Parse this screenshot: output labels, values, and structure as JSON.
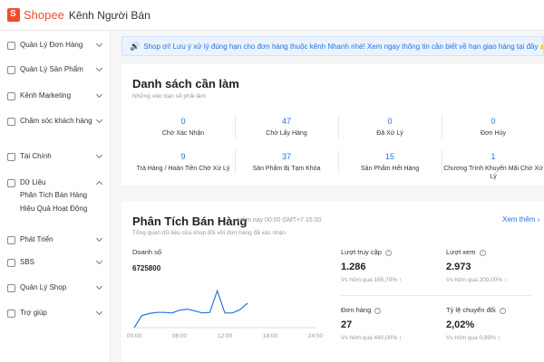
{
  "header": {
    "brand": "Shopee",
    "subtitle": "Kênh Người Bán"
  },
  "sidebar": {
    "items": [
      {
        "label": "Quản Lý Đơn Hàng",
        "icon": "order-icon"
      },
      {
        "label": "Quản Lý Sản Phẩm",
        "icon": "product-icon"
      },
      {
        "label": "Kênh Marketing",
        "icon": "tag-icon"
      },
      {
        "label": "Chăm sóc khách hàng",
        "icon": "customer-care-icon"
      },
      {
        "label": "Tài Chính",
        "icon": "finance-icon"
      },
      {
        "label": "Dữ Liệu",
        "icon": "data-icon",
        "expanded": true,
        "children": [
          "Phân Tích Bán Hàng",
          "Hiệu Quả Hoạt Động"
        ]
      },
      {
        "label": "Phát Triển",
        "icon": "growth-icon"
      },
      {
        "label": "SBS",
        "icon": "sbs-icon"
      },
      {
        "label": "Quản Lý Shop",
        "icon": "shop-icon"
      },
      {
        "label": "Trợ giúp",
        "icon": "help-icon"
      }
    ]
  },
  "notice": {
    "text": "Shop ơi! Lưu ý xử lý đúng hạn cho đơn hàng thuộc kênh Nhanh nhé! Xem ngay thông tin cần biết về hạn giao hàng tại đây 👉 Xem"
  },
  "todo": {
    "title": "Danh sách cần làm",
    "subtitle": "Những việc bạn sẽ phải làm",
    "items": [
      {
        "value": "0",
        "label": "Chờ Xác Nhận"
      },
      {
        "value": "47",
        "label": "Chờ Lấy Hàng"
      },
      {
        "value": "0",
        "label": "Đã Xử Lý"
      },
      {
        "value": "0",
        "label": "Đơn Hủy"
      },
      {
        "value": "9",
        "label": "Trả Hàng / Hoàn Tiền Chờ Xử Lý"
      },
      {
        "value": "37",
        "label": "Sản Phẩm Bị Tạm Khóa"
      },
      {
        "value": "15",
        "label": "Sản Phẩm Hết Hàng"
      },
      {
        "value": "1",
        "label": "Chương Trình Khuyến Mãi Chờ Xử Lý"
      }
    ]
  },
  "sales": {
    "title": "Phân Tích Bán Hàng",
    "date_note": "Hôm nay 00:00 GMT+7 15:00",
    "subtitle": "Tổng quan dữ liệu của shop đối với đơn hàng đã xác nhận",
    "more": "Xem thêm",
    "revenue_label": "Doanh số",
    "revenue_value": "6725800",
    "metrics": [
      {
        "label": "Lượt truy cập",
        "value": "1.286",
        "compare": "Vs hôm qua 165,70%",
        "arrow": "up"
      },
      {
        "label": "Lượt xem",
        "value": "2.973",
        "compare": "Vs hôm qua 200,00%",
        "arrow": "up"
      },
      {
        "label": "Đơn hàng",
        "value": "27",
        "compare": "Vs hôm qua 440,00%",
        "arrow": "up"
      },
      {
        "label": "Tỷ lệ chuyển đổi",
        "value": "2,02%",
        "compare": "Vs hôm qua 0,99%",
        "arrow": "up"
      }
    ]
  },
  "chart_data": {
    "type": "line",
    "x": [
      "00:00",
      "01:00",
      "02:00",
      "03:00",
      "04:00",
      "05:00",
      "06:00",
      "07:00",
      "08:00",
      "09:00",
      "10:00",
      "11:00",
      "12:00",
      "13:00",
      "14:00",
      "15:00"
    ],
    "xticks": [
      "00:00",
      "06:00",
      "12:00",
      "18:00",
      "24:00"
    ],
    "xlim": [
      0,
      24
    ],
    "series": [
      {
        "values": [
          0,
          0.22,
          0.26,
          0.28,
          0.28,
          0.27,
          0.32,
          0.34,
          0.31,
          0.27,
          0.28,
          0.68,
          0.27,
          0.27,
          0.33,
          0.45
        ]
      }
    ],
    "line_color": "#2673dd"
  }
}
